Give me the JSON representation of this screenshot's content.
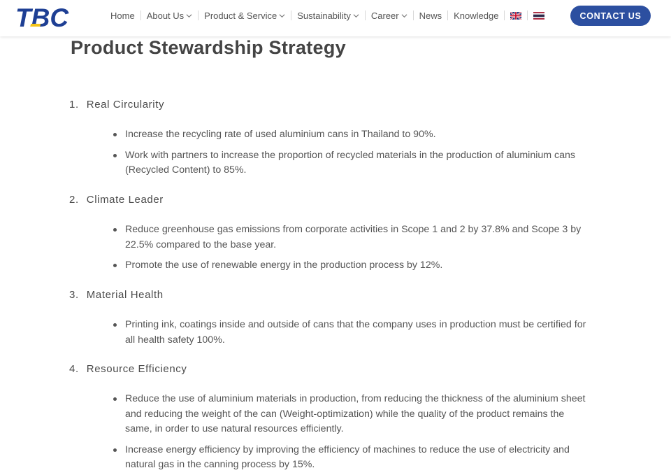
{
  "header": {
    "logo_text": "TBC",
    "nav": [
      {
        "label": "Home",
        "has_dropdown": false
      },
      {
        "label": "About Us",
        "has_dropdown": true
      },
      {
        "label": "Product & Service",
        "has_dropdown": true
      },
      {
        "label": "Sustainability",
        "has_dropdown": true
      },
      {
        "label": "Career",
        "has_dropdown": true
      },
      {
        "label": "News",
        "has_dropdown": false
      },
      {
        "label": "Knowledge",
        "has_dropdown": false
      }
    ],
    "languages": [
      "uk-flag-icon",
      "thai-flag-icon"
    ],
    "contact_label": "CONTACT US"
  },
  "colors": {
    "brand_blue": "#2c4fa0",
    "logo_blue": "#1e3f94",
    "logo_yellow": "#f5c518",
    "text": "#555555"
  },
  "page": {
    "title": "Product Stewardship Strategy",
    "sections": [
      {
        "number": "1.",
        "heading": "Real Circularity",
        "bullets": [
          "Increase the recycling rate of used aluminium cans in Thailand to 90%.",
          "Work with partners to increase the proportion of recycled materials in the production of aluminium cans (Recycled Content) to 85%."
        ]
      },
      {
        "number": "2.",
        "heading": "Climate Leader",
        "bullets": [
          "Reduce greenhouse gas emissions from corporate activities in Scope 1 and 2 by 37.8% and Scope 3 by 22.5% compared to the base year.",
          "Promote the use of renewable energy in the production process by 12%."
        ]
      },
      {
        "number": "3.",
        "heading": "Material Health",
        "bullets": [
          "Printing ink, coatings inside and outside of cans that the company uses in production must be certified for all health safety 100%."
        ]
      },
      {
        "number": "4.",
        "heading": "Resource Efficiency",
        "bullets": [
          "Reduce the use of aluminium materials in production, from reducing the thickness of the aluminium sheet and reducing the weight of the can (Weight-optimization) while the quality of the product remains the same, in order to use natural resources efficiently.",
          "Increase energy efficiency by improving the efficiency of machines to reduce the use of electricity and natural gas in the canning process by 15%."
        ]
      }
    ]
  }
}
